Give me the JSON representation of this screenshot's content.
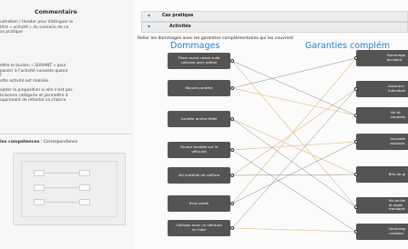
{
  "sidebar": {
    "title": "Commentaire",
    "para1": "ustration / Header pour distinguer le\ntitre « activité » du scenario de ca\nas pratique",
    "para2": "ettre le bouton « SUIVANT » pour\npasser à l'activité suivante quand\nl'\nette activité  est réalisée",
    "para3": "ejeter  la proposition si elle n'est pas\nla bonne catégorie  et permettre à\napprenant de retenter sa chance",
    "competences_label": "les compétences",
    "competences_value": ": Correspondance"
  },
  "main": {
    "bar1": "Cas pratique",
    "bar2": "Activités",
    "instruction": "Relier les dommages avec les garanties complémentaires qui les couvrent",
    "left_header": "Dommages",
    "right_header": "Garanties complém",
    "left_items": [
      "Phare avant cassé suite\ncollision avec piéton",
      "Rayure portière",
      "Lunette arrière fêlée",
      "Foudre tombée sur le\nvéhicule",
      "Vol matériel de coiffure",
      "Bras cassé",
      "Collision avec un véhicule\nen fuite"
    ],
    "right_items": [
      "Dommage\naccident",
      "Assuranc\nindividuel",
      "Vol et\nvandalis",
      "Incendie\nexplosio",
      "Bris de gl",
      "Vol accès\net objet\ntransport",
      "Dommag\ncollision"
    ]
  },
  "colors": {
    "accent": "#1b82d6",
    "box": "#545454",
    "link": "#e8c89a"
  }
}
